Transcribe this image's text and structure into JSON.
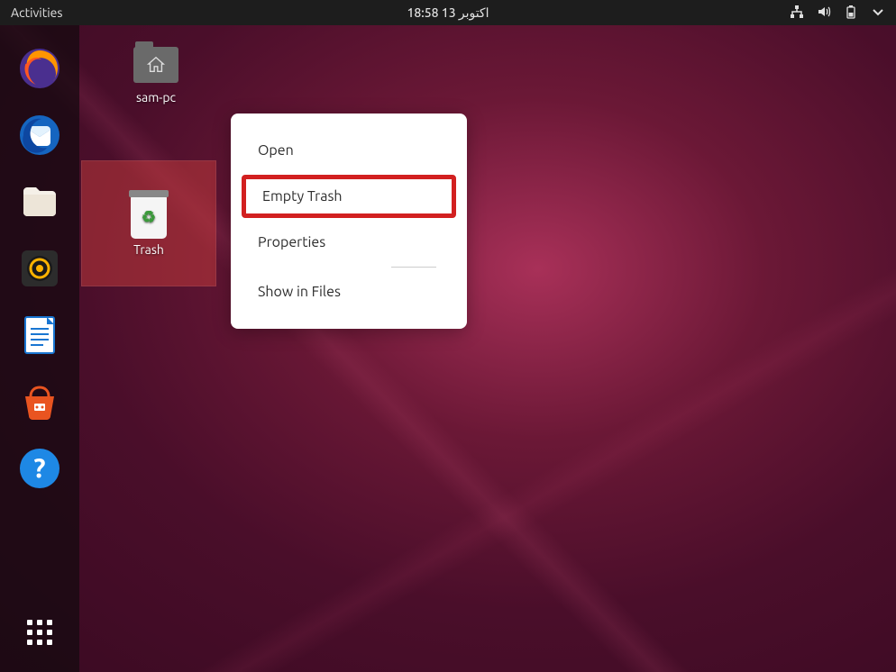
{
  "topbar": {
    "activities": "Activities",
    "datetime": "اكتوبر  13  18:58"
  },
  "desktop": {
    "home_label": "sam-pc",
    "trash_label": "Trash"
  },
  "context_menu": {
    "open": "Open",
    "empty_trash": "Empty Trash",
    "properties": "Properties",
    "show_in_files": "Show in Files"
  },
  "dock": {
    "items": [
      "firefox",
      "thunderbird",
      "files",
      "rhythmbox",
      "libreoffice-writer",
      "software-center",
      "help"
    ]
  }
}
